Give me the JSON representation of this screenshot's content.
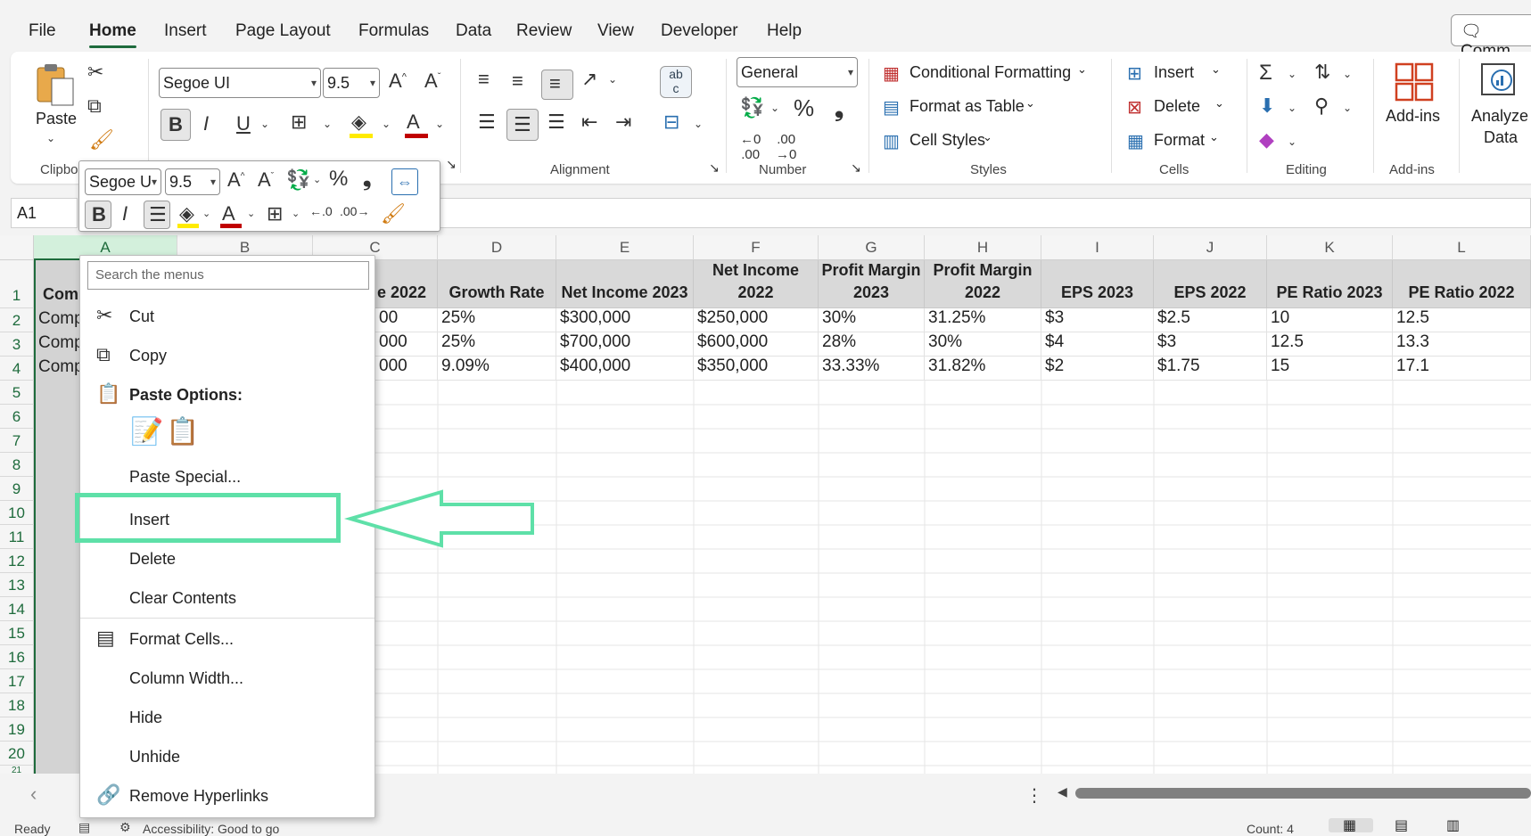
{
  "menu": {
    "tabs": [
      "File",
      "Home",
      "Insert",
      "Page Layout",
      "Formulas",
      "Data",
      "Review",
      "View",
      "Developer",
      "Help"
    ],
    "active": "Home",
    "comments_label": "Comm"
  },
  "ribbon": {
    "clipboard": {
      "paste": "Paste",
      "label": "Clipbo"
    },
    "font": {
      "name": "Segoe UI",
      "size": "9.5"
    },
    "alignment": {
      "label": "Alignment"
    },
    "number": {
      "format": "General",
      "label": "Number"
    },
    "styles": {
      "conditional": "Conditional Formatting",
      "table": "Format as Table",
      "cell_styles": "Cell Styles",
      "label": "Styles"
    },
    "cells": {
      "insert": "Insert",
      "delete": "Delete",
      "format": "Format",
      "label": "Cells"
    },
    "editing": {
      "label": "Editing"
    },
    "addins": {
      "button": "Add-ins",
      "label": "Add-ins"
    },
    "analyze": {
      "line1": "Analyze",
      "line2": "Data"
    }
  },
  "formula_bar": {
    "name_box": "A1"
  },
  "mini_toolbar": {
    "font": "Segoe U",
    "size": "9.5"
  },
  "grid": {
    "columns": [
      "A",
      "B",
      "C",
      "D",
      "E",
      "F",
      "G",
      "H",
      "I",
      "J",
      "K",
      "L"
    ],
    "rows": [
      "1",
      "2",
      "3",
      "4",
      "5",
      "6",
      "7",
      "8",
      "9",
      "10",
      "11",
      "12",
      "13",
      "14",
      "15",
      "16",
      "17",
      "18",
      "19",
      "20",
      "21"
    ],
    "col_a_visible": [
      "Com",
      "Comp",
      "Comp",
      "Comp"
    ],
    "col_c_visible": [
      "e 2022",
      "00",
      "000",
      "000"
    ],
    "headers": [
      "Growth Rate",
      "Net Income 2023",
      "Net Income 2022",
      "Profit Margin 2023",
      "Profit Margin 2022",
      "EPS 2023",
      "EPS 2022",
      "PE Ratio 2023",
      "PE Ratio 2022"
    ],
    "data": [
      [
        "25%",
        "$300,000",
        "$250,000",
        "30%",
        "31.25%",
        "$3",
        "$2.5",
        "10",
        "12.5"
      ],
      [
        "25%",
        "$700,000",
        "$600,000",
        "28%",
        "30%",
        "$4",
        "$3",
        "12.5",
        "13.3"
      ],
      [
        "9.09%",
        "$400,000",
        "$350,000",
        "33.33%",
        "31.82%",
        "$2",
        "$1.75",
        "15",
        "17.1"
      ]
    ]
  },
  "context_menu": {
    "search_placeholder": "Search the menus",
    "cut": "Cut",
    "copy": "Copy",
    "paste_options": "Paste Options:",
    "paste_special": "Paste Special...",
    "insert": "Insert",
    "delete": "Delete",
    "clear_contents": "Clear Contents",
    "format_cells": "Format Cells...",
    "column_width": "Column Width...",
    "hide": "Hide",
    "unhide": "Unhide",
    "remove_hyperlinks": "Remove Hyperlinks"
  },
  "status": {
    "ready": "Ready",
    "accessibility": "Accessibility: Good to go",
    "count": "Count: 4"
  },
  "colors": {
    "accent": "#1e6b3c",
    "highlight": "#5ee0a8"
  }
}
